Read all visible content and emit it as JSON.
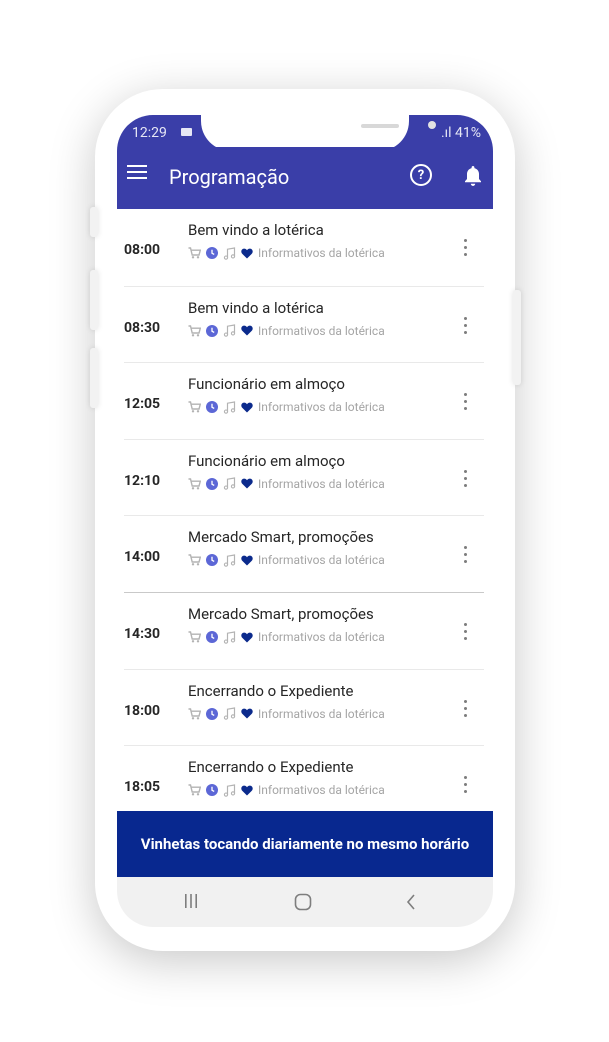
{
  "status_bar": {
    "time": "12:29",
    "signal_battery": ".ıl 41%"
  },
  "header": {
    "title": "Programação",
    "menu_icon": "menu-icon",
    "help_icon": "help-icon",
    "bell_icon": "bell-icon"
  },
  "schedule": [
    {
      "time": "08:00",
      "title": "Bem vindo a lotérica",
      "category": "Informativos da lotérica"
    },
    {
      "time": "08:30",
      "title": "Bem vindo a lotérica",
      "category": "Informativos da lotérica"
    },
    {
      "time": "12:05",
      "title": "Funcionário em almoço",
      "category": "Informativos da lotérica"
    },
    {
      "time": "12:10",
      "title": "Funcionário em almoço",
      "category": "Informativos da lotérica"
    },
    {
      "time": "14:00",
      "title": "Mercado Smart, promoções",
      "category": "Informativos da lotérica"
    },
    {
      "time": "14:30",
      "title": "Mercado Smart, promoções",
      "category": "Informativos da lotérica"
    },
    {
      "time": "18:00",
      "title": "Encerrando o Expediente",
      "category": "Informativos da lotérica"
    },
    {
      "time": "18:05",
      "title": "Encerrando o Expediente",
      "category": "Informativos da lotérica"
    }
  ],
  "row_icons": [
    "cart-icon",
    "clock-icon",
    "music-note-icon",
    "heart-icon"
  ],
  "banner": {
    "text": "Vinhetas tocando diariamente no mesmo horário"
  },
  "nav_bar": {
    "icons": [
      "recent-apps-icon",
      "home-icon",
      "back-icon"
    ]
  },
  "colors": {
    "app_bar": "#3a3ea8",
    "banner": "#08288f",
    "clock": "#5c67d6",
    "heart": "#0b2a8c"
  }
}
